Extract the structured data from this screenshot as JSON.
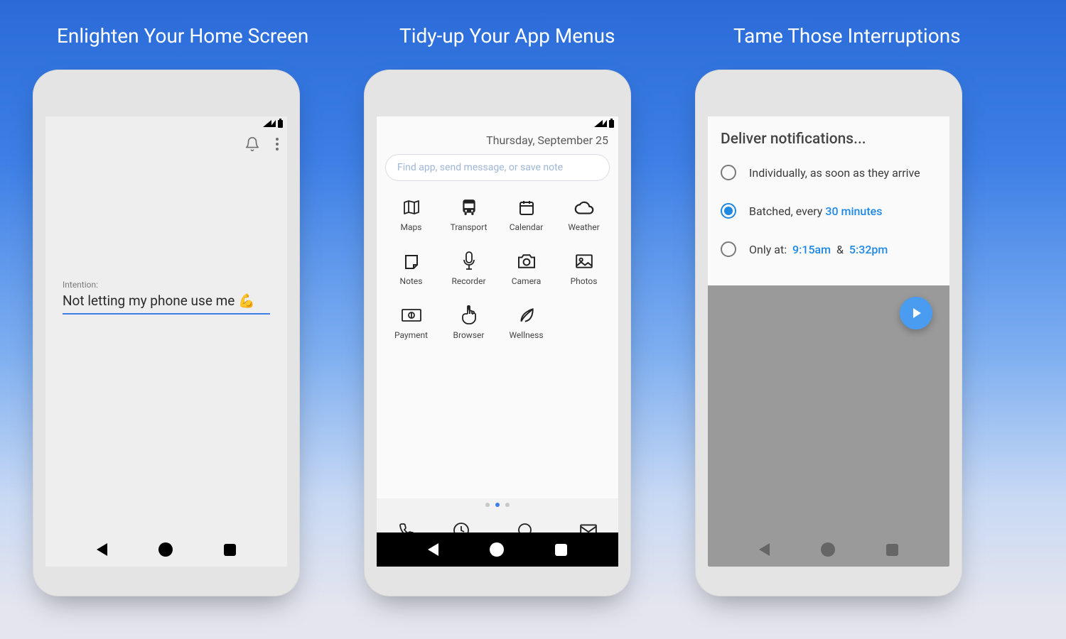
{
  "captions": {
    "c1": "Enlighten Your Home Screen",
    "c2": "Tidy-up Your App Menus",
    "c3": "Tame Those Interruptions"
  },
  "phone1": {
    "intention_label": "Intention:",
    "intention_value": "Not letting my phone use me 💪"
  },
  "phone2": {
    "date": "Thursday, September 25",
    "search_placeholder": "Find app, send message, or save note",
    "tiles": {
      "maps": "Maps",
      "transport": "Transport",
      "calendar": "Calendar",
      "weather": "Weather",
      "notes": "Notes",
      "recorder": "Recorder",
      "camera": "Camera",
      "photos": "Photos",
      "payment": "Payment",
      "browser": "Browser",
      "wellness": "Wellness"
    },
    "dock": {
      "calls": "Calls",
      "clock": "Clock",
      "messages": "Messages",
      "email": "Email"
    }
  },
  "phone3": {
    "title": "Deliver notifications...",
    "opt1": "Individually, as soon as they arrive",
    "opt2_a": "Batched, every",
    "opt2_b": "30 minutes",
    "opt3_a": "Only at:",
    "opt3_t1": "9:15am",
    "opt3_amp": "&",
    "opt3_t2": "5:32pm"
  }
}
